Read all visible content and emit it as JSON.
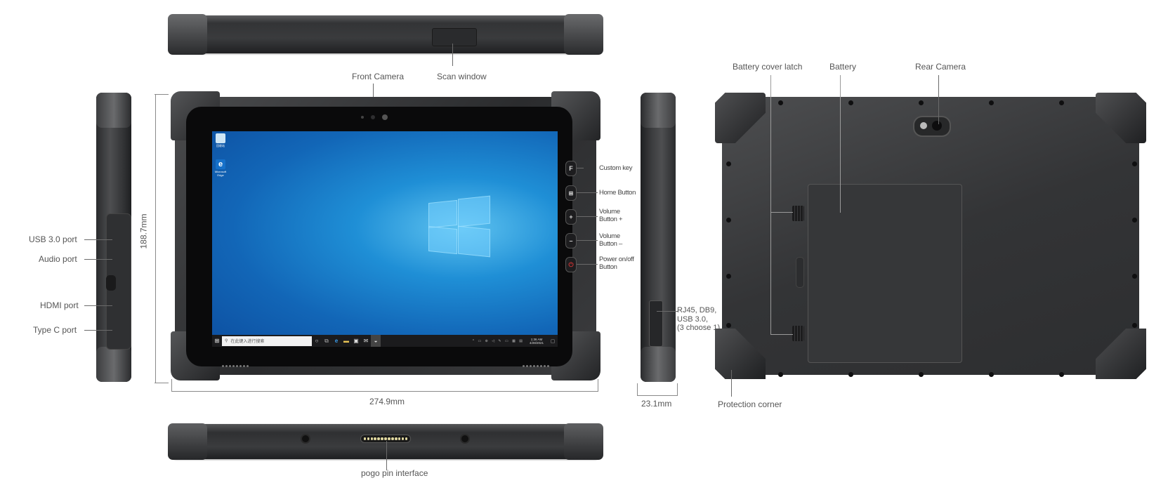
{
  "top_view": {
    "callouts": {
      "scan_window": "Scan window"
    }
  },
  "front_view": {
    "callouts": {
      "front_camera": "Front Camera",
      "custom_key": "Custom key",
      "home_button": "Home Button",
      "volume_up": "Volume Button +",
      "volume_down": "Volume Button –",
      "power": "Power on/off Button"
    },
    "volume_up_lines": [
      "Volume",
      "Button +"
    ],
    "volume_down_lines": [
      "Volume",
      "Button –"
    ],
    "power_lines": [
      "Power on/off",
      "Button"
    ],
    "buttons": {
      "custom_key_glyph": "F",
      "home_glyph": "⊞",
      "volume_up_glyph": "+",
      "volume_down_glyph": "–",
      "power_glyph": "⏻"
    },
    "screen": {
      "desktop_icons": [
        {
          "name": "recycle-bin",
          "label": "回收站"
        },
        {
          "name": "microsoft-edge",
          "label": "Microsoft Edge"
        }
      ],
      "taskbar": {
        "start_glyph": "⊞",
        "search_placeholder": "在此键入进行搜索",
        "search_glyph": "⚲",
        "cortana_glyph": "○",
        "taskview_glyph": "⧉",
        "pinned": [
          {
            "name": "edge",
            "glyph": "e"
          },
          {
            "name": "file-explorer",
            "glyph": "▬"
          },
          {
            "name": "store",
            "glyph": "▣"
          },
          {
            "name": "mail",
            "glyph": "✉"
          },
          {
            "name": "speed-app",
            "glyph": "◒"
          }
        ],
        "tray_glyphs": "^ ▭ ⊕ ◁ ✎ ▭ ▦ ▤",
        "time": "1:36 AM",
        "date": "4/28/2021",
        "notification_glyph": "▢"
      }
    },
    "dimensions": {
      "height": "188.7mm",
      "width": "274.9mm"
    }
  },
  "left_side_view": {
    "callouts": {
      "usb": "USB 3.0 port",
      "audio": "Audio port",
      "hdmi": "HDMI port",
      "typec": "Type C port"
    }
  },
  "right_side_view": {
    "callouts": {
      "expansion": "RJ45, DB9, USB 3.0, (3 choose 1)"
    },
    "expansion_lines": [
      "RJ45, DB9,",
      "USB 3.0,",
      "(3 choose 1)"
    ],
    "dimensions": {
      "thickness": "23.1mm"
    }
  },
  "back_view": {
    "callouts": {
      "battery_cover_latch": "Battery cover latch",
      "battery": "Battery",
      "rear_camera": "Rear Camera",
      "protection_corner": "Protection corner"
    }
  },
  "bottom_view": {
    "callouts": {
      "pogo": "pogo pin interface"
    },
    "pogo_pin_count": 13
  },
  "colors": {
    "device_body": "#333436",
    "screen_blue": "#1f8fd6",
    "label_text": "#555555",
    "leader_line": "#6a6a6a",
    "pogo_pin": "#e2d9a0"
  }
}
